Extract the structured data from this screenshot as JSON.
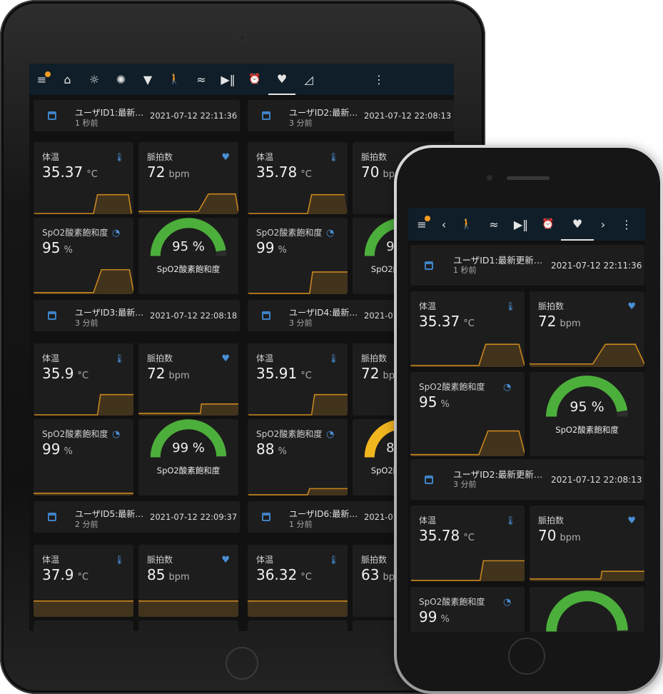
{
  "tablet": {
    "nav": [
      "menu-icon",
      "home-icon",
      "sun-icon",
      "bulb-icon",
      "desk-lamp-icon",
      "walking-icon",
      "pool-icon",
      "play-pause-icon",
      "alarm-icon",
      "heartbeat-icon",
      "area-chart-icon",
      "more-icon"
    ],
    "users": [
      {
        "title": "ユーザID1:最新…",
        "ago": "1 秒前",
        "time": "2021-07-12 22:11:36",
        "temp": "35.37",
        "pulse": "72",
        "spo2": "95",
        "gauge": "95 %",
        "pulse_dim": false
      },
      {
        "title": "ユーザID2:最新…",
        "ago": "3 分前",
        "time": "2021-07-12 22:08:13",
        "temp": "35.78",
        "pulse": "70",
        "spo2": "99",
        "gauge": "99 %",
        "pulse_dim": false
      },
      {
        "title": "ユーザID3:最新…",
        "ago": "3 分前",
        "time": "2021-07-12 22:08:18",
        "temp": "35.9",
        "pulse": "72",
        "spo2": "99",
        "gauge": "99 %"
      },
      {
        "title": "ユーザID4:最新…",
        "ago": "3 分前",
        "time": "2021-07-12 22:08:18",
        "temp": "35.91",
        "pulse": "72",
        "spo2": "88",
        "gauge": "88 %"
      },
      {
        "title": "ユーザID5:最新…",
        "ago": "2 分前",
        "time": "2021-07-12 22:09:37",
        "temp": "37.9",
        "pulse": "85"
      },
      {
        "title": "ユーザID6:最新…",
        "ago": "1 分前",
        "time": "2021-07-12 22:09:37",
        "temp": "36.32",
        "pulse": "63"
      }
    ]
  },
  "phone": {
    "nav": [
      "menu-icon",
      "chevron-left-icon",
      "walking-icon",
      "pool-icon",
      "play-pause-icon",
      "alarm-icon",
      "heartbeat-icon",
      "chevron-right-icon",
      "more-icon"
    ],
    "users": [
      {
        "title": "ユーザID1:最新更新…",
        "ago": "1 秒前",
        "time": "2021-07-12 22:11:36",
        "temp": "35.37",
        "pulse": "72",
        "spo2": "95",
        "gauge": "95 %"
      },
      {
        "title": "ユーザID2:最新更新…",
        "ago": "3 分前",
        "time": "2021-07-12 22:08:13",
        "temp": "35.78",
        "pulse": "70",
        "spo2": "99"
      }
    ]
  },
  "labels": {
    "temp": "体温",
    "temp_unit": "°C",
    "pulse": "脈拍数",
    "pulse_unit": "bpm",
    "spo2": "SpO2酸素飽和度",
    "spo2_unit": "%",
    "gauge_name": "SpO2酸素飽和度"
  },
  "colors": {
    "topbar": "#0f1e29",
    "card": "#1d1d1d",
    "accent_line": "#c7861f",
    "gauge_green": "#4caf3b",
    "gauge_amber": "#f2b61f",
    "gauge_track": "#2d2d2d",
    "icon_blue": "#4a8fd6",
    "badge": "#f59b22"
  }
}
